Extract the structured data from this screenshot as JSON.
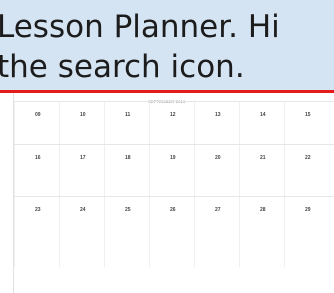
{
  "caption": {
    "line1": "Lesson Planner. Hi",
    "line2": "the search icon."
  },
  "colors": {
    "caption_bg": "#d5e4f3",
    "underline": "#e31b1b"
  },
  "calendar": {
    "month_label": "SEPTEMBER 2019",
    "weeks": [
      [
        "09",
        "10",
        "11",
        "12",
        "13",
        "14",
        "15"
      ],
      [
        "16",
        "17",
        "18",
        "19",
        "20",
        "21",
        "22"
      ],
      [
        "23",
        "24",
        "25",
        "26",
        "27",
        "28",
        "29"
      ]
    ]
  }
}
